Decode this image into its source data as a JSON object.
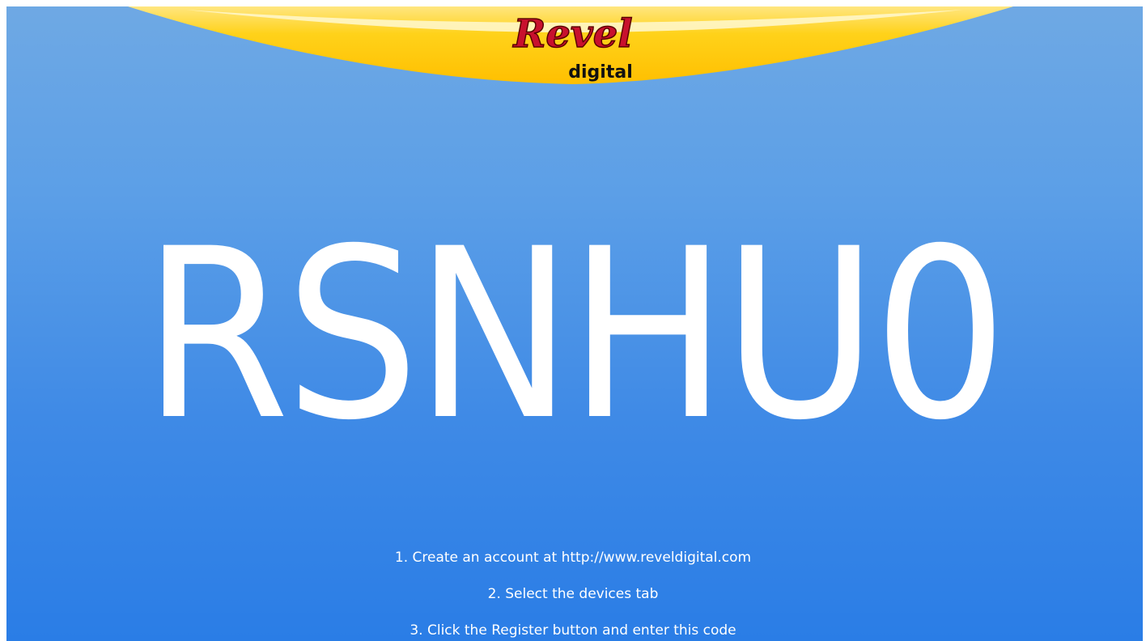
{
  "brand": {
    "logo_text": "Revel",
    "logo_subtext": "digital",
    "logo_color": "#c8102e",
    "banner_color": "#ffcc00"
  },
  "registration": {
    "code": "RSNHU0"
  },
  "instructions": {
    "step1": "1. Create an account at http://www.reveldigital.com",
    "step2": "2. Select the devices tab",
    "step3": "3. Click the Register button and enter this code"
  }
}
